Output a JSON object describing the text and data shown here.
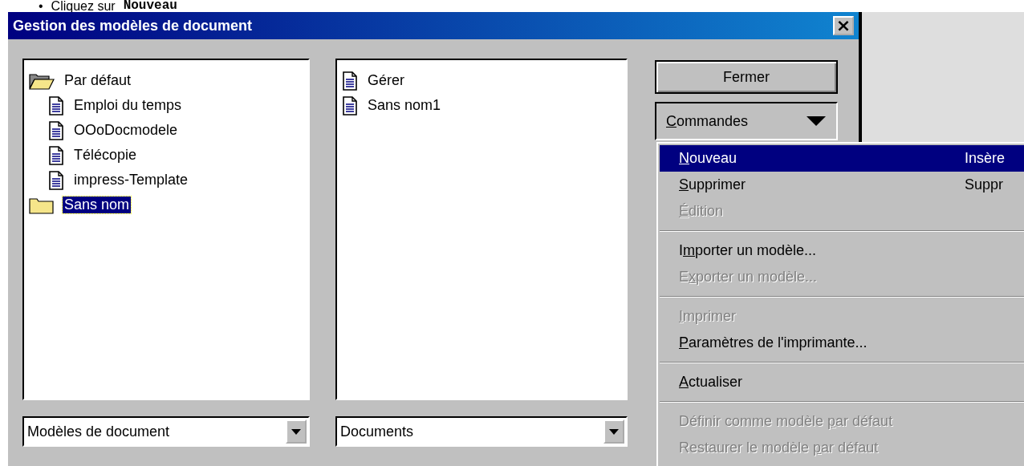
{
  "instruction": {
    "bullet": "•",
    "text": "Cliquez sur",
    "command": "Nouveau"
  },
  "window": {
    "title": "Gestion des modèles de document",
    "close": "×"
  },
  "left_tree": [
    {
      "label": "Par défaut",
      "expanded": true,
      "selected": false,
      "children": [
        {
          "label": "Emploi du temps",
          "selected": false
        },
        {
          "label": "OOoDocmodele",
          "selected": false
        },
        {
          "label": "Télécopie",
          "selected": false
        },
        {
          "label": "impress-Template",
          "selected": false
        }
      ]
    },
    {
      "label": "Sans nom",
      "expanded": false,
      "selected": true
    }
  ],
  "right_list": [
    {
      "label": "Gérer",
      "selected": false
    },
    {
      "label": "Sans nom1",
      "selected": false
    }
  ],
  "buttons": {
    "close": "Fermer",
    "commands": {
      "mnemonic": "C",
      "rest": "ommandes"
    }
  },
  "left_dropdown": {
    "value": "Modèles de document"
  },
  "right_dropdown": {
    "value": "Documents"
  },
  "menu": [
    {
      "kind": "item",
      "mnemonic": "N",
      "rest": "ouveau",
      "shortcut": "Insère",
      "selected": true,
      "disabled": false
    },
    {
      "kind": "item",
      "mnemonic": "S",
      "rest": "upprimer",
      "shortcut": "Suppr",
      "selected": false,
      "disabled": false
    },
    {
      "kind": "item",
      "mnemonic": "É",
      "rest": "dition",
      "selected": false,
      "disabled": true
    },
    {
      "kind": "separator"
    },
    {
      "kind": "item",
      "prefix": "I",
      "mnemonic": "m",
      "rest": "porter un modèle...",
      "selected": false,
      "disabled": false
    },
    {
      "kind": "item",
      "prefix": "E",
      "mnemonic": "x",
      "rest": "porter un modèle...",
      "selected": false,
      "disabled": true
    },
    {
      "kind": "separator"
    },
    {
      "kind": "item",
      "mnemonic": "I",
      "rest": "mprimer",
      "selected": false,
      "disabled": true
    },
    {
      "kind": "item",
      "mnemonic": "P",
      "rest": "aramètres de l'imprimante...",
      "selected": false,
      "disabled": false
    },
    {
      "kind": "separator"
    },
    {
      "kind": "item",
      "mnemonic": "A",
      "rest": "ctualiser",
      "selected": false,
      "disabled": false
    },
    {
      "kind": "separator"
    },
    {
      "kind": "item",
      "prefix": "Définir comme modèle ",
      "mnemonic": "p",
      "rest": "ar défaut",
      "selected": false,
      "disabled": true
    },
    {
      "kind": "item",
      "prefix": "Restaurer le modèle ",
      "mnemonic": "p",
      "rest": "ar défaut",
      "selected": false,
      "disabled": true
    }
  ]
}
